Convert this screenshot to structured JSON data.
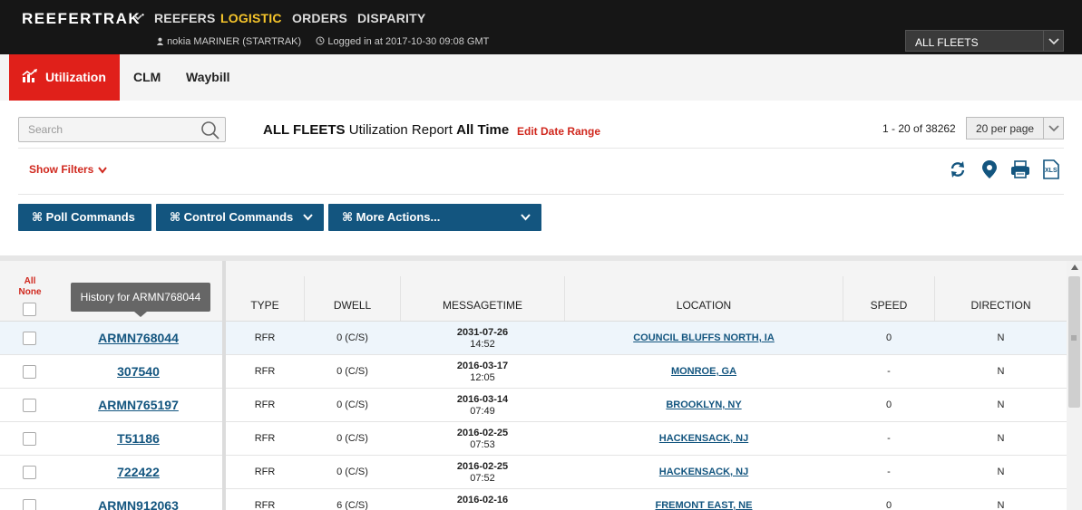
{
  "header": {
    "brand": "REEFERTRAK",
    "brand_mark": "•",
    "nav": [
      "REEFERS",
      "LOGISTIC",
      "ORDERS",
      "DISPARITY"
    ],
    "active_nav": "LOGISTIC",
    "user": "nokia MARINER (STARTRAK)",
    "login": "Logged in at 2017-10-30 09:08 GMT",
    "fleet_select": "ALL FLEETS"
  },
  "tabs": {
    "utilization": "Utilization",
    "clm": "CLM",
    "waybill": "Waybill"
  },
  "toolbar": {
    "search_placeholder": "Search",
    "report_fleet": "ALL FLEETS",
    "report_name": "Utilization Report",
    "report_range": "All Time",
    "edit_date": "Edit Date Range",
    "page_count": "1 - 20 of 38262",
    "per_page": "20 per page",
    "show_filters": "Show Filters"
  },
  "commands": {
    "poll": "⌘ Poll Commands",
    "control": "⌘ Control Commands",
    "more": "⌘ More Actions..."
  },
  "table": {
    "select_all": "All",
    "select_none": "None",
    "tooltip": "History for ARMN768044",
    "columns": [
      "TYPE",
      "DWELL",
      "MESSAGETIME",
      "LOCATION",
      "SPEED",
      "DIRECTION"
    ],
    "rows": [
      {
        "id": "ARMN768044",
        "type": "RFR",
        "dwell": "0 (C/S)",
        "date": "2031-07-26",
        "time": "14:52",
        "location": "COUNCIL BLUFFS NORTH, IA",
        "speed": "0",
        "direction": "N"
      },
      {
        "id": "307540",
        "type": "RFR",
        "dwell": "0 (C/S)",
        "date": "2016-03-17",
        "time": "12:05",
        "location": "MONROE, GA",
        "speed": "-",
        "direction": "N"
      },
      {
        "id": "ARMN765197",
        "type": "RFR",
        "dwell": "0 (C/S)",
        "date": "2016-03-14",
        "time": "07:49",
        "location": "BROOKLYN, NY",
        "speed": "0",
        "direction": "N"
      },
      {
        "id": "T51186",
        "type": "RFR",
        "dwell": "0 (C/S)",
        "date": "2016-02-25",
        "time": "07:53",
        "location": "HACKENSACK, NJ",
        "speed": "-",
        "direction": "N"
      },
      {
        "id": "722422",
        "type": "RFR",
        "dwell": "0 (C/S)",
        "date": "2016-02-25",
        "time": "07:52",
        "location": "HACKENSACK, NJ",
        "speed": "-",
        "direction": "N"
      },
      {
        "id": "ARMN912063",
        "type": "RFR",
        "dwell": "6 (C/S)",
        "date": "2016-02-16",
        "time": "",
        "location": "FREMONT EAST, NE",
        "speed": "0",
        "direction": "N"
      }
    ]
  },
  "colors": {
    "accent_red": "#e0201a",
    "link_blue": "#13557f",
    "active_nav": "#f6c52b"
  }
}
